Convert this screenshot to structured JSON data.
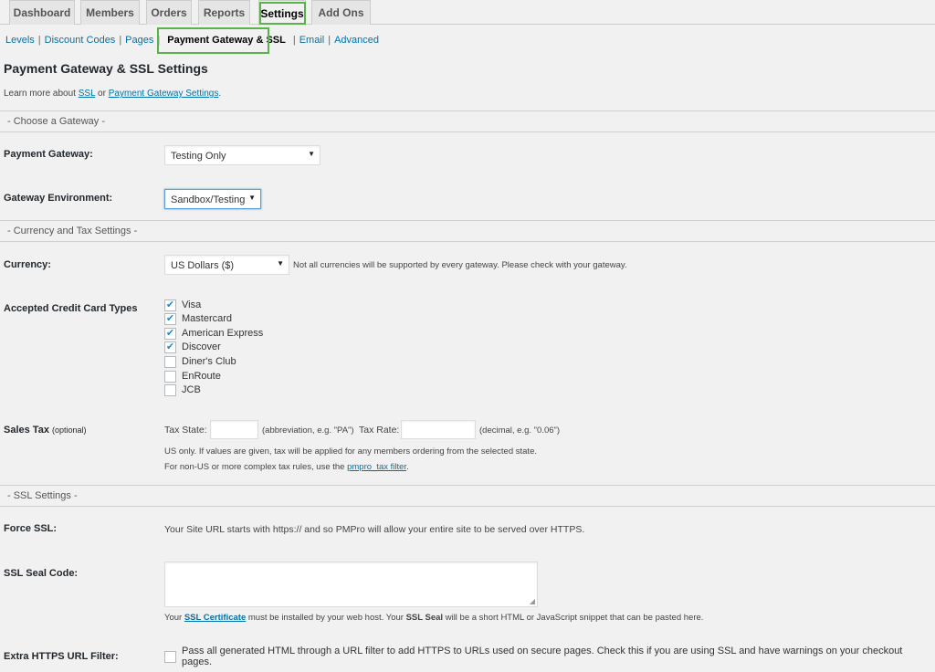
{
  "tabs": [
    {
      "label": "Dashboard"
    },
    {
      "label": "Members"
    },
    {
      "label": "Orders"
    },
    {
      "label": "Reports"
    },
    {
      "label": "Settings"
    },
    {
      "label": "Add Ons"
    }
  ],
  "subnav": {
    "levels": "Levels",
    "discount_codes": "Discount Codes",
    "pages": "Pages",
    "payment_gateway": "Payment Gateway & SSL",
    "email": "Email",
    "advanced": "Advanced",
    "sep": "|"
  },
  "page_title": "Payment Gateway & SSL Settings",
  "learn": {
    "prefix": "Learn more about",
    "ssl_link": "SSL",
    "or": "or",
    "gateway_link": "Payment Gateway Settings",
    "suffix": "."
  },
  "sections": {
    "gateway": "- Choose a Gateway -",
    "currency": "- Currency and Tax Settings -",
    "ssl": "- SSL Settings -"
  },
  "payment_gateway": {
    "label": "Payment Gateway:",
    "value": "Testing Only"
  },
  "gateway_environment": {
    "label": "Gateway Environment:",
    "value": "Sandbox/Testing"
  },
  "currency": {
    "label": "Currency:",
    "value": "US Dollars ($)",
    "note": "Not all currencies will be supported by every gateway. Please check with your gateway."
  },
  "cards": {
    "label": "Accepted Credit Card Types",
    "items": [
      {
        "label": "Visa",
        "checked": true
      },
      {
        "label": "Mastercard",
        "checked": true
      },
      {
        "label": "American Express",
        "checked": true
      },
      {
        "label": "Discover",
        "checked": true
      },
      {
        "label": "Diner's Club",
        "checked": false
      },
      {
        "label": "EnRoute",
        "checked": false
      },
      {
        "label": "JCB",
        "checked": false
      }
    ]
  },
  "sales_tax": {
    "label": "Sales Tax",
    "optional": "(optional)",
    "state_label": "Tax State:",
    "state_value": "",
    "state_hint": "(abbreviation, e.g. \"PA\")",
    "rate_label": "Tax Rate:",
    "rate_value": "",
    "rate_hint": "(decimal, e.g. \"0.06\")",
    "note1": "US only. If values are given, tax will be applied for any members ordering from the selected state.",
    "note2_prefix": "For non-US or more complex tax rules, use the",
    "note2_link": "pmpro_tax filter",
    "note2_suffix": "."
  },
  "force_ssl": {
    "label": "Force SSL:",
    "text": "Your Site URL starts with https:// and so PMPro will allow your entire site to be served over HTTPS."
  },
  "ssl_seal": {
    "label": "SSL Seal Code:",
    "value": "",
    "note_prefix": "Your",
    "note_link": "SSL Certificate",
    "note_mid": "must be installed by your web host. Your",
    "note_bold": "SSL Seal",
    "note_suffix": "will be a short HTML or JavaScript snippet that can be pasted here."
  },
  "https_filter": {
    "label": "Extra HTTPS URL Filter:",
    "checked": false,
    "text": "Pass all generated HTML through a URL filter to add HTTPS to URLs used on secure pages. Check this if you are using SSL and have warnings on your checkout pages."
  },
  "icons": {
    "dropdown": "triangle-down",
    "check": "checkmark",
    "resize": "resize-grip"
  },
  "colors": {
    "link": "#0073aa",
    "highlight": "#5ab34a",
    "check": "#1e8cbe"
  }
}
